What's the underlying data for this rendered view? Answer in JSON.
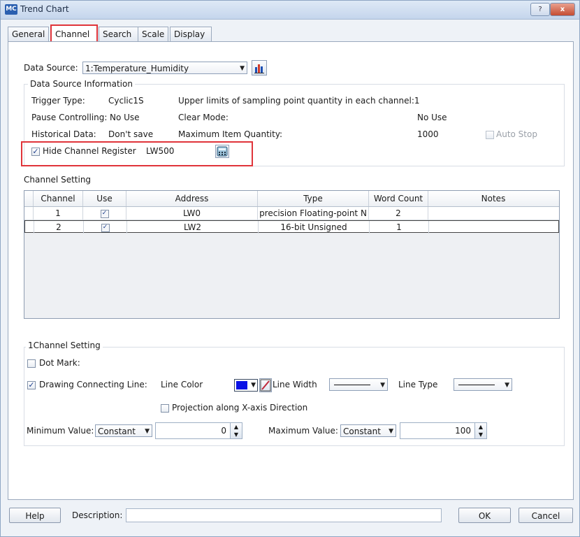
{
  "window": {
    "title": "Trend Chart",
    "app_icon": "MC",
    "help": "?",
    "close": "x"
  },
  "tabs": [
    "General",
    "Channel",
    "Search",
    "Scale",
    "Display"
  ],
  "data_source": {
    "label": "Data Source:",
    "value": "1:Temperature_Humidity",
    "icon": "chart-icon"
  },
  "info": {
    "title": "Data Source Information",
    "trigger_type_label": "Trigger Type:",
    "trigger_type_value": "Cyclic1S",
    "upper_limits": "Upper limits of sampling point quantity in each channel:1",
    "pause_label": "Pause Controlling:",
    "pause_value": "No Use",
    "clear_mode_label": "Clear Mode:",
    "clear_mode_value": "No Use",
    "historical_label": "Historical Data:",
    "historical_value": "Don't save",
    "max_item_label": "Maximum Item Quantity:",
    "max_item_value": "1000",
    "auto_stop": "Auto Stop",
    "hide_register_label": "Hide Channel Register",
    "hide_register_value": "LW500"
  },
  "channel_setting": {
    "title": "Channel Setting",
    "columns": [
      "Channel",
      "Use",
      "Address",
      "Type",
      "Word Count",
      "Notes"
    ],
    "rows": [
      {
        "channel": "1",
        "use": "✓",
        "address": "LW0",
        "type": "precision Floating-point N",
        "word_count": "2",
        "notes": ""
      },
      {
        "channel": "2",
        "use": "✓",
        "address": "LW2",
        "type": "16-bit Unsigned",
        "word_count": "1",
        "notes": ""
      }
    ]
  },
  "ch_setting": {
    "title": "1Channel Setting",
    "dot_mark": "Dot Mark:",
    "drawing_line": "Drawing Connecting Line:",
    "line_color": "Line Color",
    "line_color_hex": "#0a12e6",
    "line_width": "Line Width",
    "line_type": "Line Type",
    "projection": "Projection along X-axis Direction",
    "min_label": "Minimum Value:",
    "min_mode": "Constant",
    "min_value": "0",
    "max_label": "Maximum Value:",
    "max_mode": "Constant",
    "max_value": "100"
  },
  "footer": {
    "help": "Help",
    "description": "Description:",
    "ok": "OK",
    "cancel": "Cancel"
  }
}
